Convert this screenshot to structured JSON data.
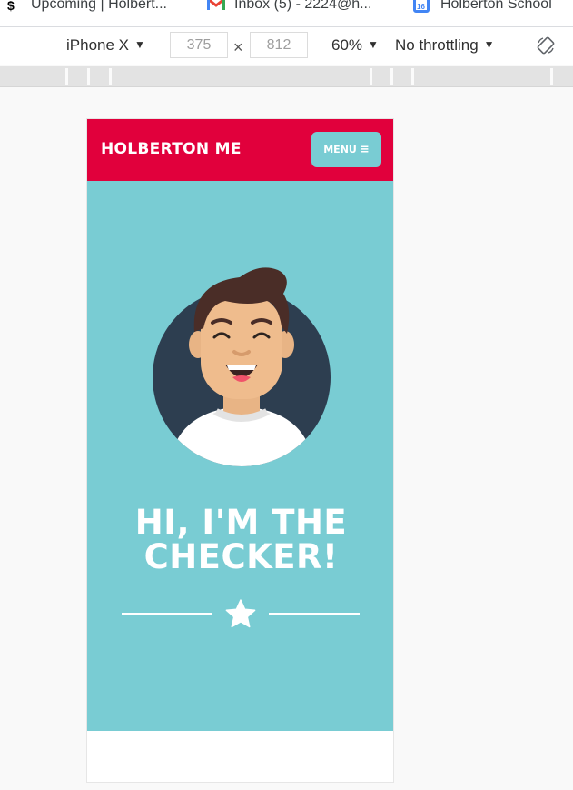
{
  "bookmarks": [
    {
      "label": "Upcoming | Holbert...",
      "icon": "holberton-favicon"
    },
    {
      "label": "Inbox (5) - 2224@h...",
      "icon": "gmail-icon"
    },
    {
      "label": "Holberton School",
      "icon": "calendar-icon"
    }
  ],
  "devtools": {
    "device": "iPhone X",
    "width": "375",
    "separator": "×",
    "height": "812",
    "zoom": "60%",
    "throttling": "No throttling",
    "rotate_icon": "rotate-icon"
  },
  "site": {
    "brand": "HOLBERTON ME",
    "menu_label": "MENU",
    "menu_icon": "≡",
    "hero_title_line1": "HI, I'M THE",
    "hero_title_line2": "CHECKER!",
    "divider_icon": "star-icon"
  },
  "colors": {
    "header": "#e1003c",
    "hero": "#79ccd3",
    "avatar_bg": "#2d3e50"
  }
}
